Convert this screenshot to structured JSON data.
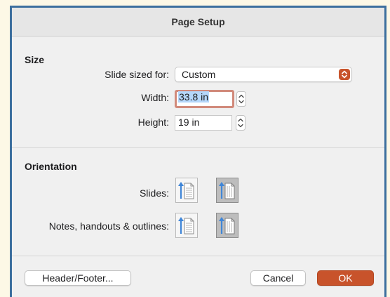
{
  "dialog": {
    "title": "Page Setup",
    "size_section": "Size",
    "slide_sized_for_label": "Slide sized for:",
    "slide_sized_for_value": "Custom",
    "width_label": "Width:",
    "width_value": "33.8 in",
    "height_label": "Height:",
    "height_value": "19 in",
    "orientation_section": "Orientation",
    "slides_label": "Slides:",
    "notes_label": "Notes, handouts & outlines:",
    "header_footer_button": "Header/Footer...",
    "cancel_button": "Cancel",
    "ok_button": "OK"
  },
  "orientation": {
    "slides": "landscape",
    "notes": "landscape"
  },
  "colors": {
    "accent": "#c8532b",
    "focus_ring": "#d18a7b",
    "selection_highlight": "#b5d7fb",
    "arrow": "#3f86d8",
    "window_frame": "#3d6f9e"
  },
  "icons": {
    "popup": "chevron-up-down-icon",
    "stepper": "stepper-arrows-icon",
    "portrait": "portrait-orientation-icon",
    "landscape": "landscape-orientation-icon"
  }
}
